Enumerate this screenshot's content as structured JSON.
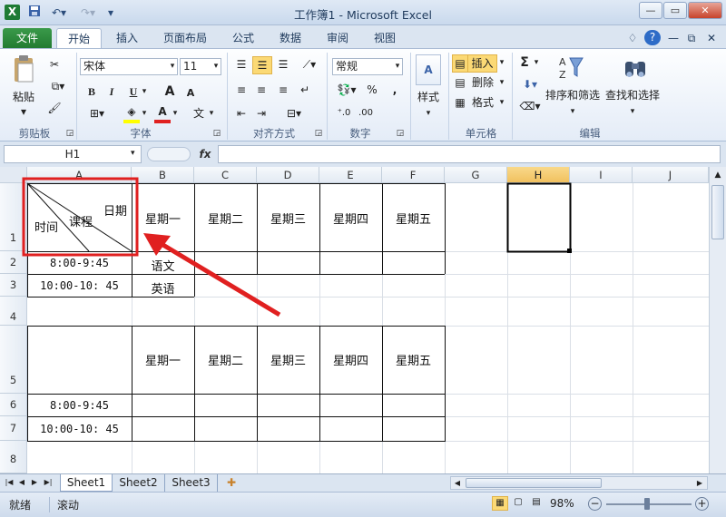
{
  "window": {
    "title": "工作簿1 - Microsoft Excel"
  },
  "qat": {
    "save_icon": "save-icon",
    "undo_icon": "undo-icon",
    "redo_icon": "redo-icon"
  },
  "tabs": [
    "文件",
    "开始",
    "插入",
    "页面布局",
    "公式",
    "数据",
    "审阅",
    "视图"
  ],
  "ribbon": {
    "clipboard": {
      "paste": "粘贴",
      "label": "剪贴板"
    },
    "font": {
      "name": "宋体",
      "size": "11",
      "bold": "B",
      "italic": "I",
      "underline": "U",
      "grow": "A",
      "shrink": "A",
      "label": "字体",
      "wen": "文"
    },
    "alignment": {
      "label": "对齐方式"
    },
    "number": {
      "format": "常规",
      "percent": "%",
      "comma": ",",
      "label": "数字"
    },
    "styles": {
      "label": "样式"
    },
    "cells": {
      "insert": "插入",
      "delete": "删除",
      "format": "格式",
      "label": "单元格"
    },
    "editing": {
      "sigma": "Σ",
      "sort": "排序和筛选",
      "find": "查找和选择",
      "label": "编辑"
    }
  },
  "formula_bar": {
    "namebox": "H1",
    "fx": "fx",
    "content": ""
  },
  "columns": [
    "A",
    "B",
    "C",
    "D",
    "E",
    "F",
    "G",
    "H",
    "I",
    "J"
  ],
  "rows": [
    "1",
    "2",
    "3",
    "4",
    "5",
    "6",
    "7",
    "8"
  ],
  "table1": {
    "header": {
      "diag_date": "日期",
      "diag_course": "课程",
      "diag_time": "时间"
    },
    "days": [
      "星期一",
      "星期二",
      "星期三",
      "星期四",
      "星期五"
    ],
    "times": [
      "8:00-9:45",
      "10:00-10: 45"
    ],
    "subjects": [
      "语文",
      "英语"
    ]
  },
  "table2": {
    "days": [
      "星期一",
      "星期二",
      "星期三",
      "星期四",
      "星期五"
    ],
    "times": [
      "8:00-9:45",
      "10:00-10: 45"
    ]
  },
  "sheets": [
    "Sheet1",
    "Sheet2",
    "Sheet3"
  ],
  "status": {
    "ready": "就绪",
    "scroll": "滚动",
    "zoom": "98%"
  },
  "colors": {
    "highlight": "#e02020",
    "file_tab": "#217a30",
    "selection": "#000000"
  }
}
